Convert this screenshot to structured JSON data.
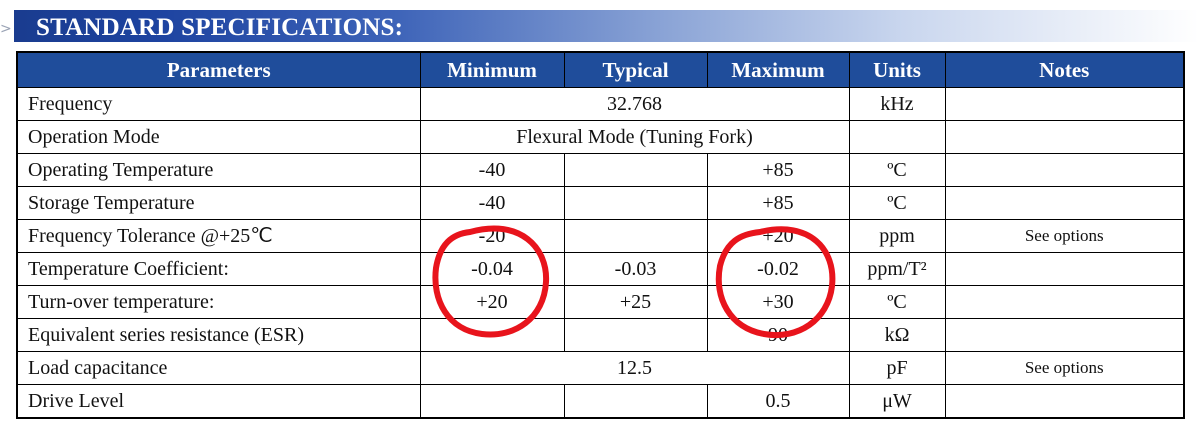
{
  "banner": {
    "arrow": ">",
    "title": "STANDARD SPECIFICATIONS:"
  },
  "table": {
    "headers": [
      "Parameters",
      "Minimum",
      "Typical",
      "Maximum",
      "Units",
      "Notes"
    ],
    "rows": [
      {
        "parameter": "Frequency",
        "span_value": "32.768",
        "units": "kHz",
        "notes": ""
      },
      {
        "parameter": "Operation Mode",
        "span_value": "Flexural Mode (Tuning Fork)",
        "units": "",
        "notes": ""
      },
      {
        "parameter": "Operating Temperature",
        "min": "-40",
        "typ": "",
        "max": "+85",
        "units": "ºC",
        "notes": ""
      },
      {
        "parameter": "Storage Temperature",
        "min": "-40",
        "typ": "",
        "max": "+85",
        "units": "ºC",
        "notes": ""
      },
      {
        "parameter": "Frequency Tolerance @+25℃",
        "min": "-20",
        "typ": "",
        "max": "+20",
        "units": "ppm",
        "notes": "See options"
      },
      {
        "parameter": "Temperature Coefficient:",
        "min": "-0.04",
        "typ": "-0.03",
        "max": "-0.02",
        "units": "ppm/T²",
        "notes": ""
      },
      {
        "parameter": "Turn-over temperature:",
        "min": "+20",
        "typ": "+25",
        "max": "+30",
        "units": "ºC",
        "notes": ""
      },
      {
        "parameter": "Equivalent series resistance (ESR)",
        "min": "",
        "typ": "",
        "max": "90",
        "units": "kΩ",
        "notes": ""
      },
      {
        "parameter": "Load capacitance",
        "span_value": "12.5",
        "units": "pF",
        "notes": "See options"
      },
      {
        "parameter": "Drive Level",
        "min": "",
        "typ": "",
        "max": "0.5",
        "units": "μW",
        "notes": ""
      }
    ]
  },
  "annotations": {
    "circle_color": "#e8141c"
  }
}
